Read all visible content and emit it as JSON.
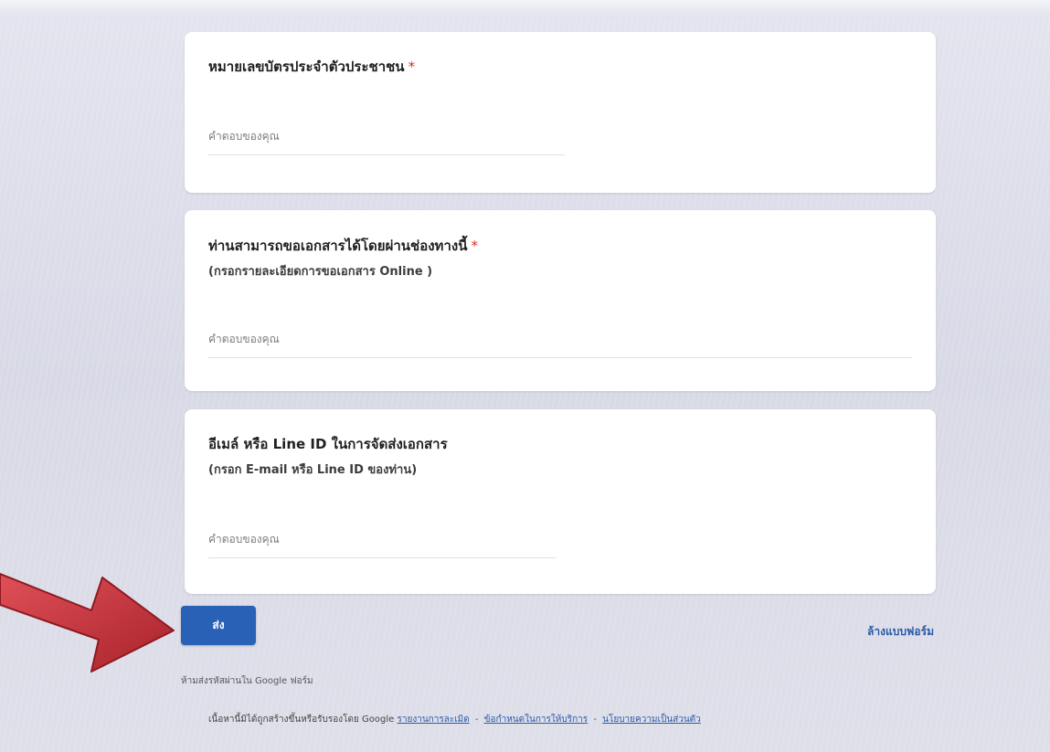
{
  "form": {
    "questions": [
      {
        "title": "หมายเลขบัตรประจำตัวประชาชน",
        "required_mark": "*",
        "description": "",
        "answer_placeholder": "คำตอบของคุณ"
      },
      {
        "title": "ท่านสามารถขอเอกสารได้โดยผ่านช่องทางนี้",
        "required_mark": "*",
        "description": "(กรอกรายละเอียดการขอเอกสาร Online )",
        "answer_placeholder": "คำตอบของคุณ"
      },
      {
        "title": "อีเมล์ หรือ Line ID ในการจัดส่งเอกสาร",
        "required_mark": "",
        "description": "(กรอก E-mail หรือ Line ID ของท่าน)",
        "answer_placeholder": "คำตอบของคุณ"
      }
    ],
    "submit_label": "ส่ง",
    "clear_label": "ล้างแบบฟอร์ม",
    "password_notice": "ห้ามส่งรหัสผ่านใน Google ฟอร์ม",
    "footer": {
      "text": "เนื้อหานี้มิได้ถูกสร้างขึ้นหรือรับรองโดย Google",
      "links": [
        "รายงานการละเมิด",
        "ข้อกำหนดในการให้บริการ",
        "นโยบายความเป็นส่วนตัว"
      ],
      "separator": "-"
    }
  },
  "colors": {
    "background": "#dcdde8",
    "card": "#ffffff",
    "submit_button": "#2861b6",
    "link": "#2a5aa8",
    "required": "#d93025",
    "annotation_arrow": "#c8323a"
  },
  "icons": {
    "annotation": "red-arrow-icon"
  }
}
